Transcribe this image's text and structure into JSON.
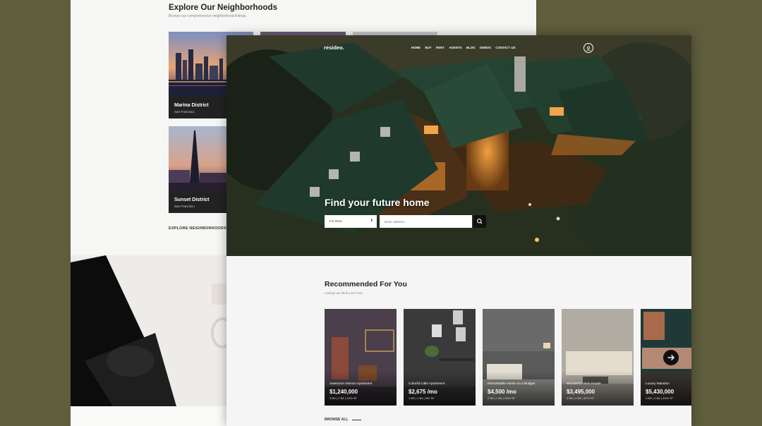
{
  "back_page": {
    "title": "Explore Our Neighborhoods",
    "subtitle": "Browse our comprehensive neighborhood listings.",
    "cards": [
      {
        "name": "Marina District",
        "city": "San Francisco"
      },
      {
        "name": "Sunset District",
        "city": "San Francisco"
      }
    ],
    "explore_link": "EXPLORE NEIGHBORHOODS"
  },
  "front_page": {
    "logo": "resideo.",
    "nav": [
      "HOME",
      "BUY",
      "RENT",
      "AGENTS",
      "BLOG",
      "DEMOS",
      "CONTACT US"
    ],
    "user_icon": "user-icon",
    "hero_title": "Find your future home",
    "search": {
      "select_value": "For Rent",
      "address_placeholder": "Enter address...",
      "button_icon": "search-icon"
    },
    "recommended": {
      "title": "Recommended For You",
      "subtitle": "Listings we think you'll love.",
      "listings": [
        {
          "title": "Awesome Interior Apartment",
          "price": "$1,240,000",
          "meta": "3 BD | 2 BA | 1200 SF"
        },
        {
          "title": "Colorful Little Apartment",
          "price": "$2,675 /mo",
          "meta": "1 BD | 1 BA | 500 SF"
        },
        {
          "title": "Remarkable Home on a Budget",
          "price": "$4,500 /mo",
          "meta": "2 BD | 1 BA | 2000 SF"
        },
        {
          "title": "Wonderful View House",
          "price": "$3,495,000",
          "meta": "3 BD | 4 BA | 4576 SF"
        },
        {
          "title": "Luxury Mansion",
          "price": "$5,430,000",
          "meta": "4 BD | 3 BA | 4200 SF"
        }
      ],
      "next_icon": "arrow-right-icon",
      "browse_all": "BROWSE ALL"
    }
  },
  "colors": {
    "background": "#5e5d3c",
    "accent_dark": "#111111",
    "roof_green": "#1f3a2c"
  }
}
